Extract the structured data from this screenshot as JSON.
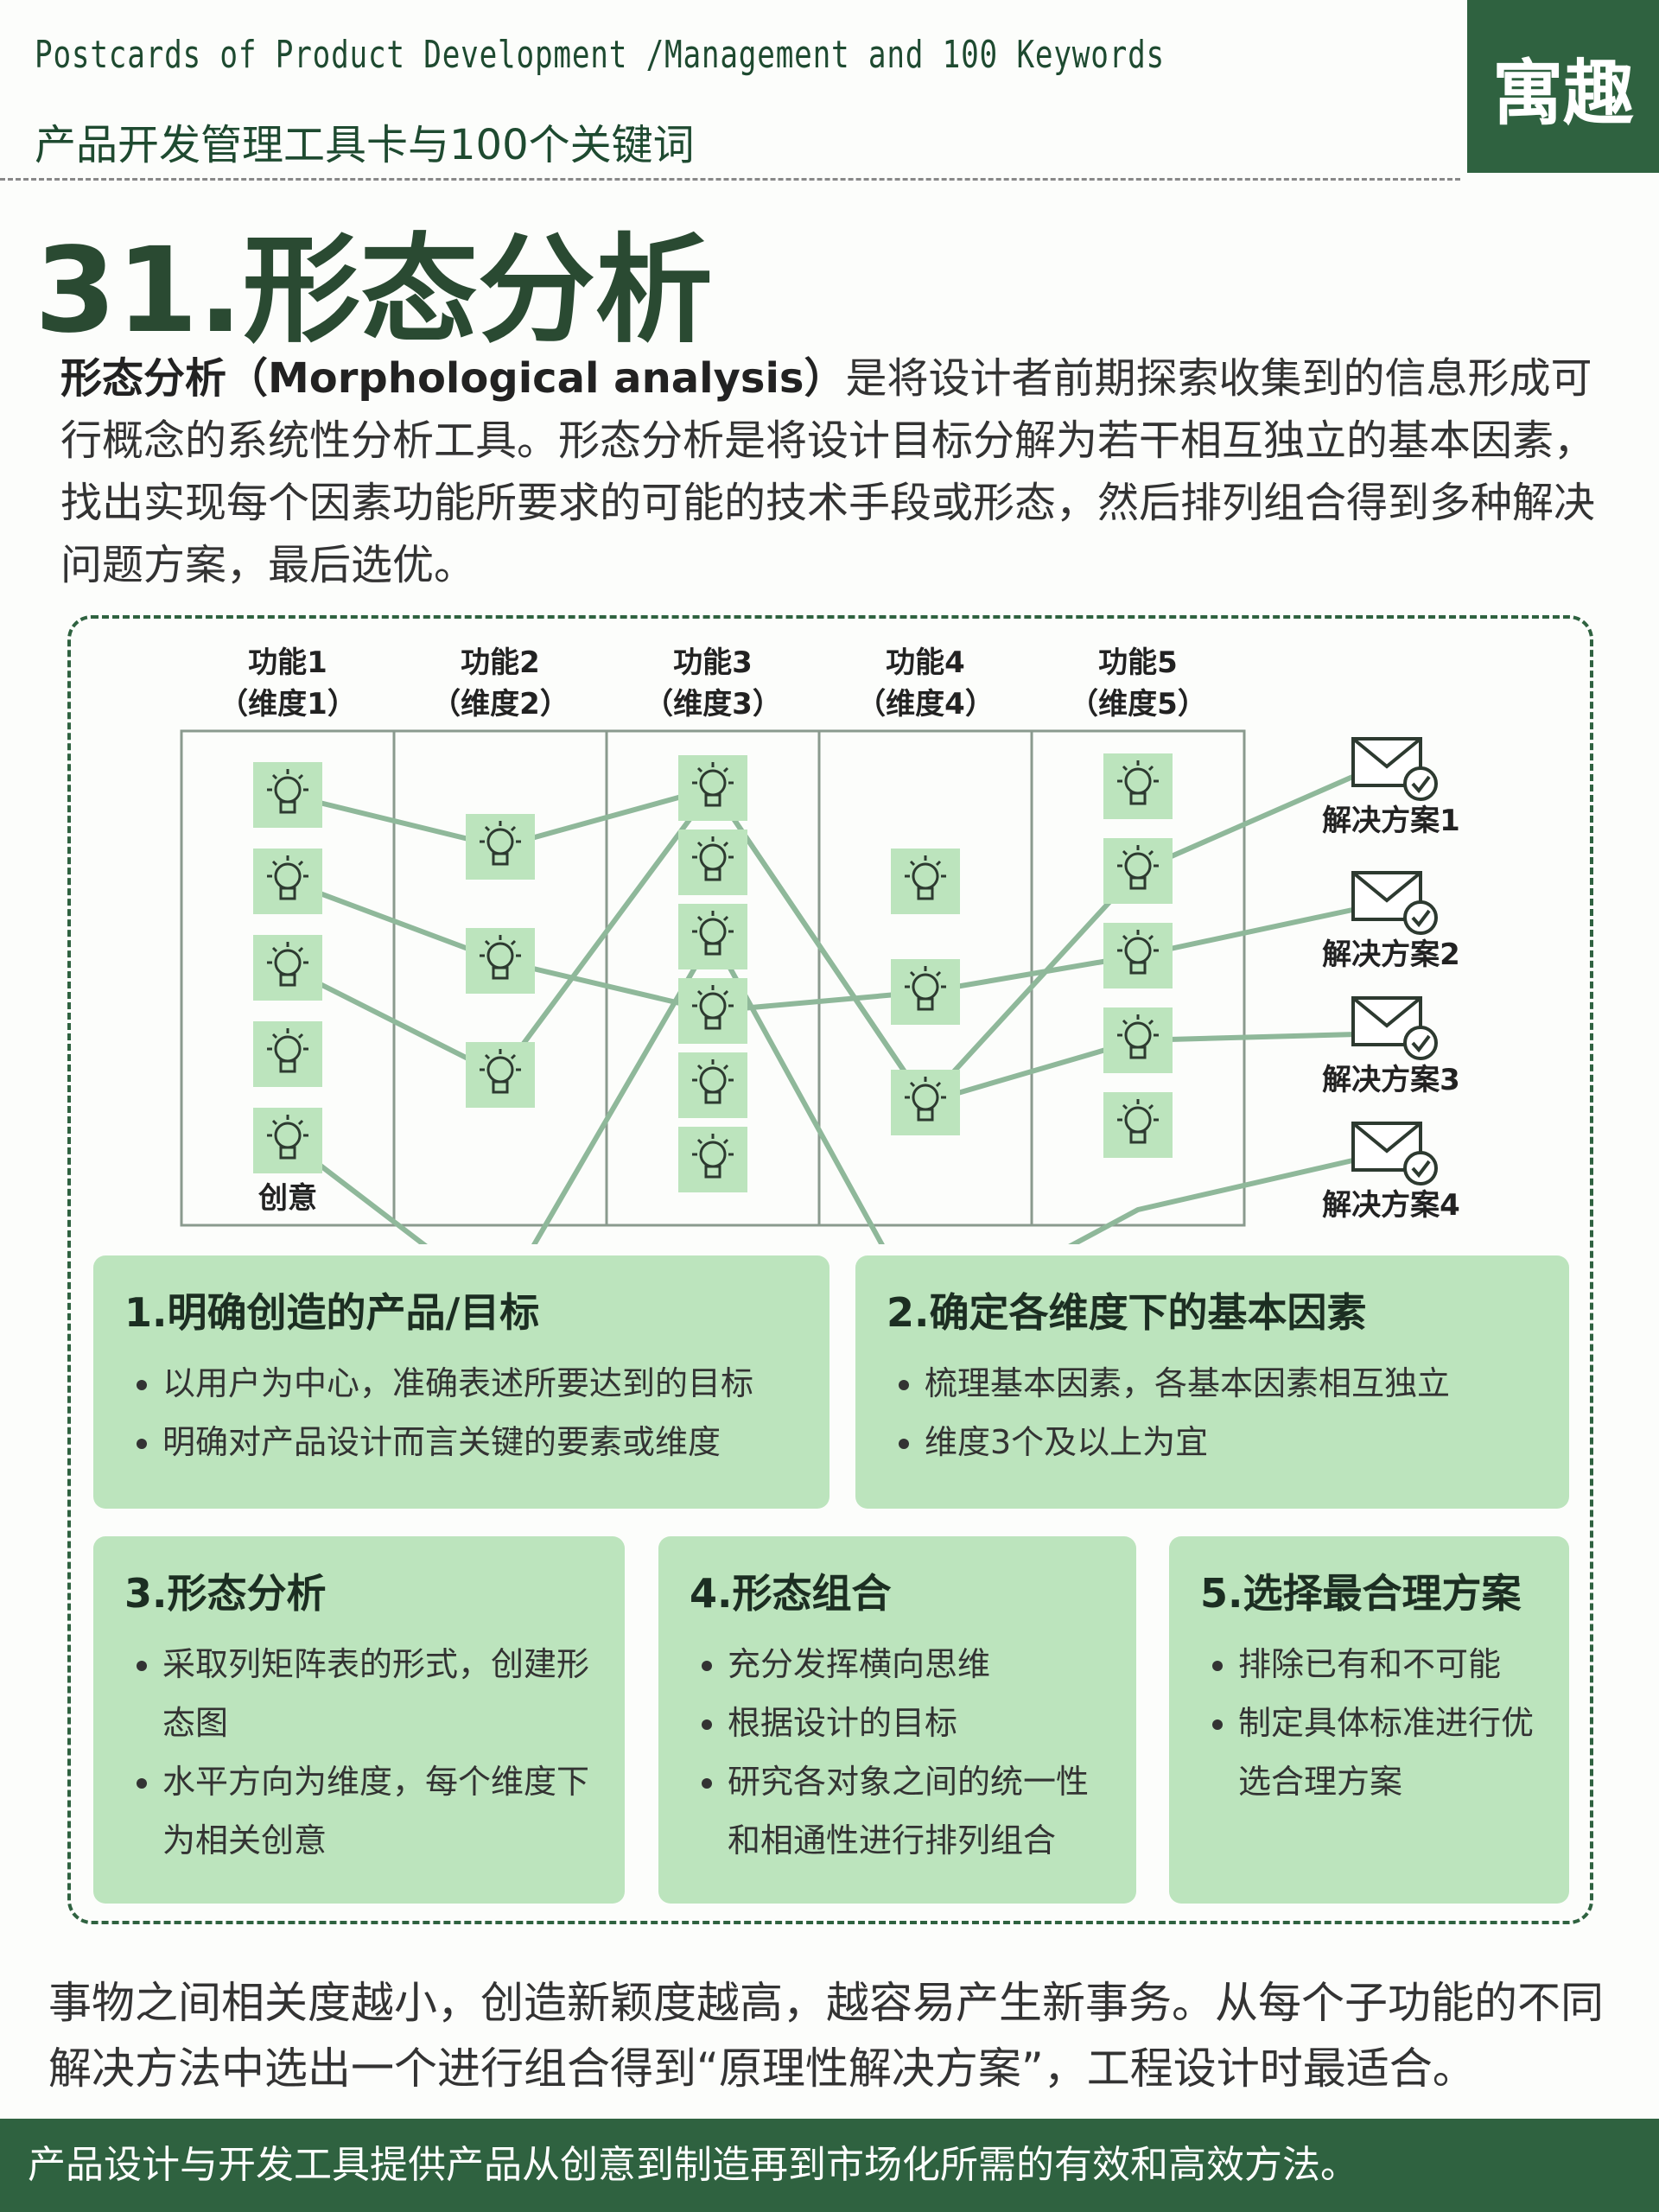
{
  "header": {
    "title_en": "Postcards of Product Development /Management and 100 Keywords",
    "title_cn": "产品开发管理工具卡与100个关键词",
    "brand": "寓趣"
  },
  "page_title": "31.形态分析",
  "intro": {
    "term": "形态分析（Morphological analysis）",
    "text": "是将设计者前期探索收集到的信息形成可行概念的系统性分析工具。形态分析是将设计目标分解为若干相互独立的基本因素，找出实现每个因素功能所要求的可能的技术手段或形态，然后排列组合得到多种解决问题方案，最后选优。"
  },
  "diagram": {
    "columns": [
      {
        "title": "功能1",
        "subtitle": "（维度1）",
        "ideas": 5
      },
      {
        "title": "功能2",
        "subtitle": "（维度2）",
        "ideas": 3
      },
      {
        "title": "功能3",
        "subtitle": "（维度3）",
        "ideas": 6
      },
      {
        "title": "功能4",
        "subtitle": "（维度4）",
        "ideas": 3
      },
      {
        "title": "功能5",
        "subtitle": "（维度5）",
        "ideas": 5
      }
    ],
    "idea_label": "创意",
    "solutions": [
      "解决方案1",
      "解决方案2",
      "解决方案3",
      "解决方案4"
    ],
    "paths": [
      [
        0,
        0,
        0,
        2,
        1
      ],
      [
        1,
        1,
        3,
        1,
        2
      ],
      [
        2,
        2,
        0,
        2,
        3
      ],
      [
        4,
        4,
        2,
        4,
        5
      ]
    ],
    "bulb_icon": "lightbulb-icon",
    "solution_icon": "envelope-check-icon",
    "accent": "#2f6240",
    "tile_color": "#bce4bd"
  },
  "steps": [
    {
      "title": "1.明确创造的产品/目标",
      "items": [
        "以用户为中心，准确表述所要达到的目标",
        "明确对产品设计而言关键的要素或维度"
      ]
    },
    {
      "title": "2.确定各维度下的基本因素",
      "items": [
        "梳理基本因素，各基本因素相互独立",
        "维度3个及以上为宜"
      ]
    },
    {
      "title": "3.形态分析",
      "items": [
        "采取列矩阵表的形式，创建形态图",
        "水平方向为维度，每个维度下为相关创意"
      ]
    },
    {
      "title": "4.形态组合",
      "items": [
        "充分发挥横向思维",
        "根据设计的目标",
        "研究各对象之间的统一性和相通性进行排列组合"
      ]
    },
    {
      "title": "5.选择最合理方案",
      "items": [
        "排除已有和不可能",
        "制定具体标准进行优选合理方案"
      ]
    }
  ],
  "closing": "事物之间相关度越小，创造新颖度越高，越容易产生新事务。从每个子功能的不同解决方法中选出一个进行组合得到“原理性解决方案”，工程设计时最适合。",
  "footer": "产品设计与开发工具提供产品从创意到制造再到市场化所需的有效和高效方法。"
}
